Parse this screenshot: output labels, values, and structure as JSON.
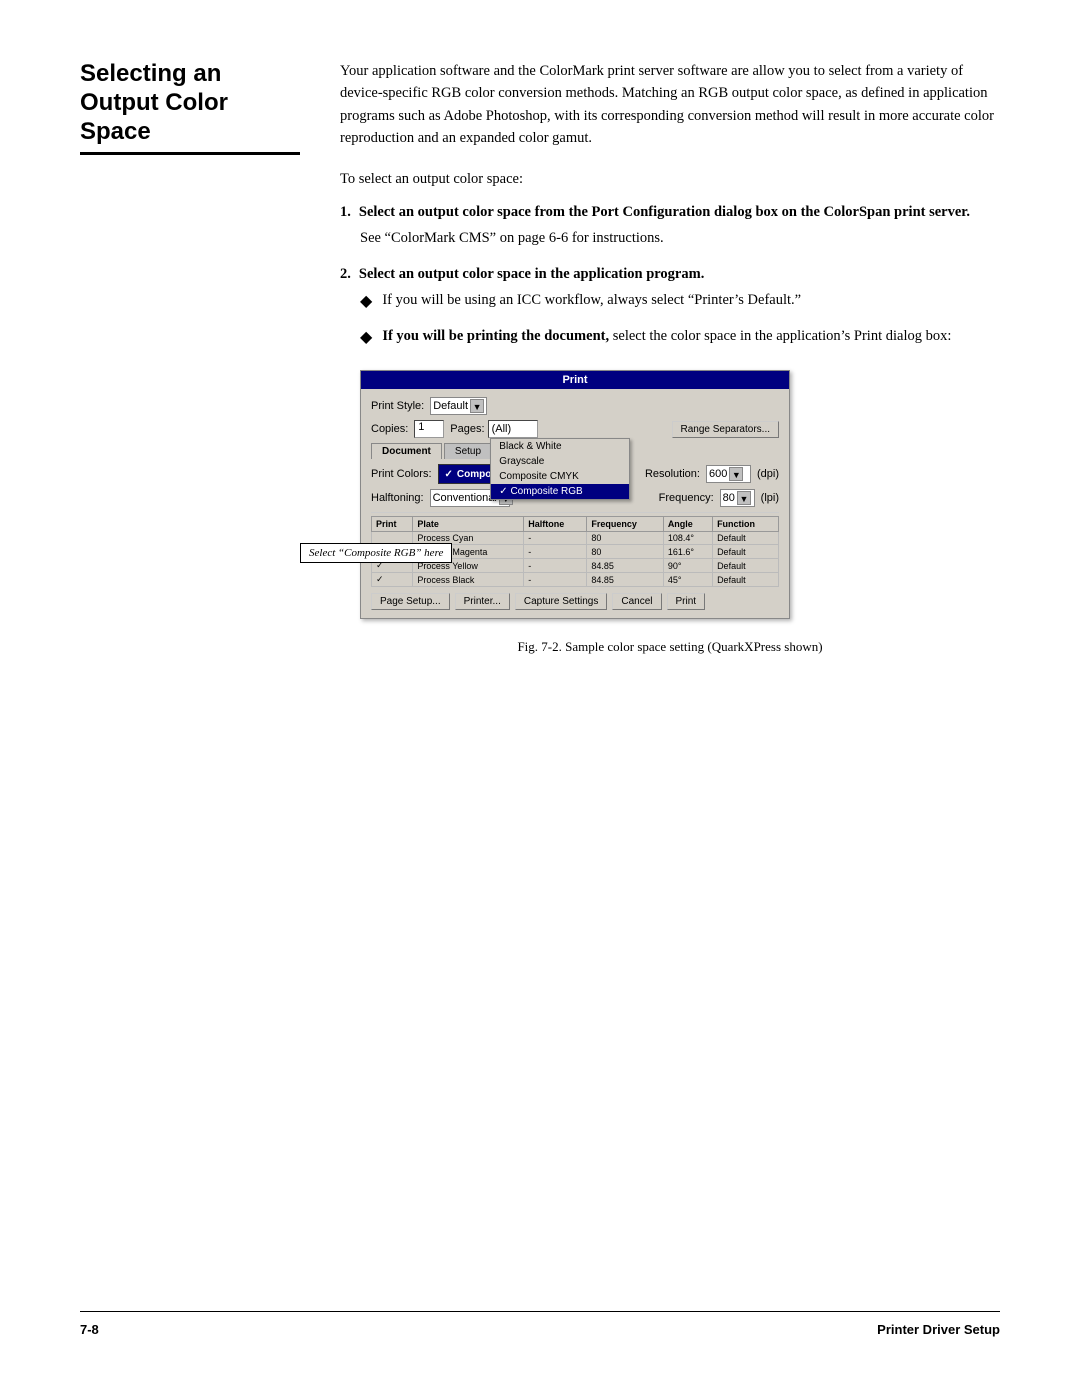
{
  "page": {
    "section_title": "Selecting an Output Color Space",
    "footer_left": "7-8",
    "footer_right": "Printer Driver Setup",
    "fig_caption": "Fig. 7-2. Sample color space setting (QuarkXPress shown)"
  },
  "content": {
    "intro_paragraph": "Your application software and the ColorMark print server software are allow you to select from a variety of device-specific RGB color conversion methods. Matching an RGB output color space, as defined in application programs such as Adobe Photoshop, with its corresponding conversion method will result in more accurate color reproduction and an expanded color gamut.",
    "to_select_text": "To select an output color space:",
    "step1_label": "1.",
    "step1_text": "Select an output color space from the Port Configuration dialog box on the ColorSpan print server.",
    "step1_sub": "See “ColorMark CMS” on page 6-6 for instructions.",
    "step2_label": "2.",
    "step2_text": "Select an output color space in the application program.",
    "bullet1_text": "If you will be using an ICC workflow, always select “Printer’s Default.”",
    "bullet2_text_start": "If you will be printing the document,",
    "bullet2_text_end": " select the color space in the application’s Print dialog box:"
  },
  "print_dialog": {
    "title": "Print",
    "print_style_label": "Print Style:",
    "print_style_value": "Default",
    "copies_label": "Copies:",
    "copies_value": "1",
    "pages_label": "Pages:",
    "pages_value": "(All)",
    "range_separators_btn": "Range Separators...",
    "tab_document": "Document",
    "tab_setup": "Setup",
    "dropdown_options": [
      "Black & White",
      "Grayscale",
      "Composite CMYK",
      "Composite RGB"
    ],
    "dropdown_selected": "Composite RGB",
    "print_colors_label": "Print Colors:",
    "print_colors_checkmark": "✓",
    "halftoning_label": "Halftoning:",
    "halftoning_value": "Conventional",
    "resolution_label": "Resolution:",
    "resolution_value": "600",
    "resolution_unit": "(dpi)",
    "frequency_label": "Frequency:",
    "frequency_value": "80",
    "frequency_unit": "(lpi)",
    "table_headers": [
      "Print",
      "Plate",
      "Halftone",
      "Frequency",
      "Angle",
      "Function"
    ],
    "table_rows": [
      [
        "",
        "Process Cyan",
        "-",
        "80",
        "108.4°",
        "Default"
      ],
      [
        "✓",
        "Process Magenta",
        "-",
        "80",
        "161.6°",
        "Default"
      ],
      [
        "✓",
        "Process Yellow",
        "-",
        "84.85",
        "90°",
        "Default"
      ],
      [
        "✓",
        "Process Black",
        "-",
        "84.85",
        "45°",
        "Default"
      ]
    ],
    "btn_page_setup": "Page Setup...",
    "btn_printer": "Printer...",
    "btn_capture_settings": "Capture Settings",
    "btn_cancel": "Cancel",
    "btn_print": "Print"
  },
  "callout": {
    "text": "Select “Composite RGB” here"
  }
}
